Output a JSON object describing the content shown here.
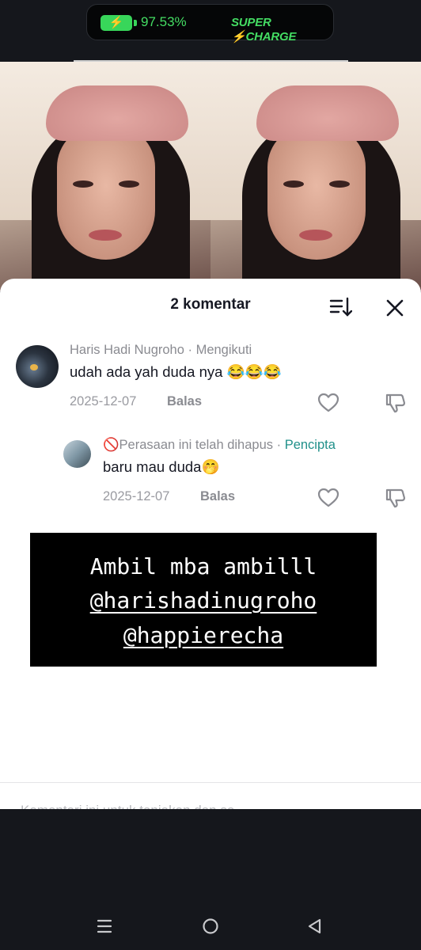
{
  "status_bar": {
    "battery_percent": "97.53%",
    "charge_label": "SUPER ⚡CHARGE",
    "accent_color": "#44dd63"
  },
  "comments_panel": {
    "title": "2 komentar",
    "sort_icon": "sort-icon",
    "close_icon": "close-icon",
    "comments": [
      {
        "author": "Haris Hadi Nugroho",
        "relation": "· Mengikuti",
        "text": "udah ada yah duda nya 😂😂😂",
        "date": "2025-12-07",
        "reply_label": "Balas"
      }
    ],
    "replies": [
      {
        "author": "🚫Perasaan ini telah dihapus",
        "separator": " · ",
        "badge": "Pencipta",
        "text": "baru mau duda🤭",
        "date": "2025-12-07",
        "reply_label": "Balas"
      }
    ],
    "input_placeholder_partial": "Komentari ini untuk tanjakan dan se..."
  },
  "overlay_caption": {
    "line1": "Ambil mba ambilll",
    "mention1": "@harishadinugroho",
    "mention2": "@happierecha"
  },
  "nav_bar": {
    "icons": [
      "menu-icon",
      "home-icon",
      "back-icon"
    ]
  }
}
